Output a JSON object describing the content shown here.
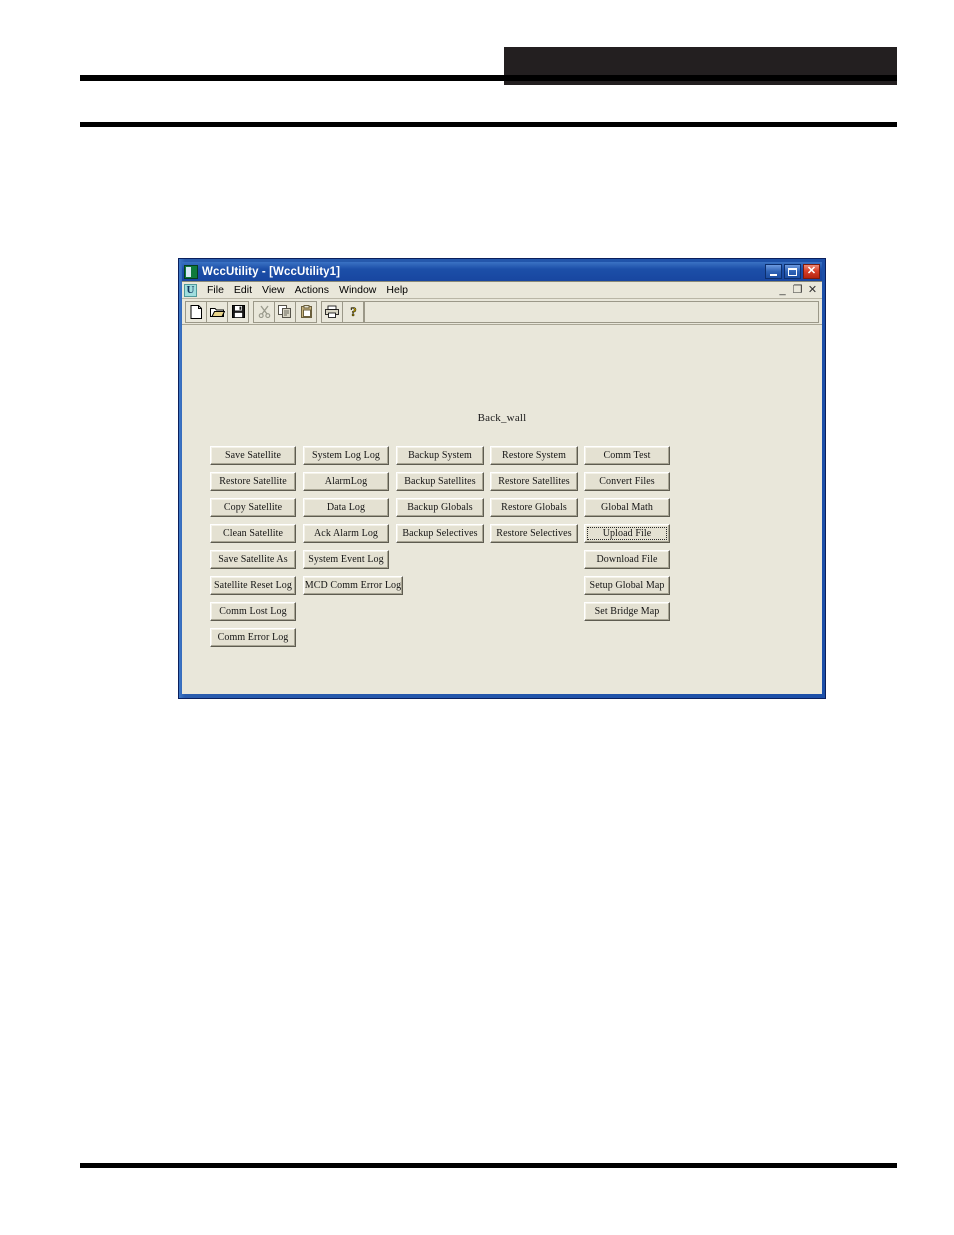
{
  "page": {
    "header_block_color": "#231f20",
    "rule_color": "#000000"
  },
  "window": {
    "title": "WccUtility - [WccUtility1]",
    "app_icon": "wcc-app-icon",
    "title_buttons": [
      {
        "name": "minimize",
        "label": "_"
      },
      {
        "name": "maximize",
        "label": "□"
      },
      {
        "name": "close",
        "label": "✕"
      }
    ],
    "accent_color": "#1c4fa8",
    "client_color": "#e9e7da"
  },
  "menu": {
    "mdi_icon_letter": "U",
    "items": [
      "File",
      "Edit",
      "View",
      "Actions",
      "Window",
      "Help"
    ],
    "mdi_buttons": [
      {
        "name": "mdi-minimize",
        "label": "_"
      },
      {
        "name": "mdi-restore",
        "label": "❐"
      },
      {
        "name": "mdi-close",
        "label": "✕"
      }
    ]
  },
  "toolbar": {
    "groups": [
      [
        "new-file-icon",
        "open-folder-icon",
        "save-floppy-icon"
      ],
      [
        "cut-scissors-icon",
        "copy-icon",
        "paste-icon"
      ],
      [
        "print-icon",
        "help-question-icon"
      ]
    ]
  },
  "form": {
    "title": "Back_wall",
    "focused_button": "Upload File",
    "columns": [
      {
        "name": "satellite-column",
        "buttons": [
          "Save Satellite",
          "Restore Satellite",
          "Copy Satellite",
          "Clean Satellite",
          "Save Satellite As",
          "Satellite Reset Log",
          "Comm Lost Log",
          "Comm Error Log"
        ]
      },
      {
        "name": "log-column",
        "buttons": [
          "System Log Log",
          "AlarmLog",
          "Data Log",
          "Ack Alarm Log",
          "System Event Log",
          "MCD Comm Error Log"
        ]
      },
      {
        "name": "backup-column",
        "buttons": [
          "Backup System",
          "Backup Satellites",
          "Backup Globals",
          "Backup Selectives"
        ]
      },
      {
        "name": "restore-column",
        "buttons": [
          "Restore System",
          "Restore Satellites",
          "Restore Globals",
          "Restore Selectives"
        ]
      },
      {
        "name": "tools-column",
        "buttons": [
          "Comm Test",
          "Convert Files",
          "Global Math",
          "Upload File",
          "Download File",
          "Setup Global Map",
          "Set Bridge Map"
        ]
      }
    ]
  }
}
